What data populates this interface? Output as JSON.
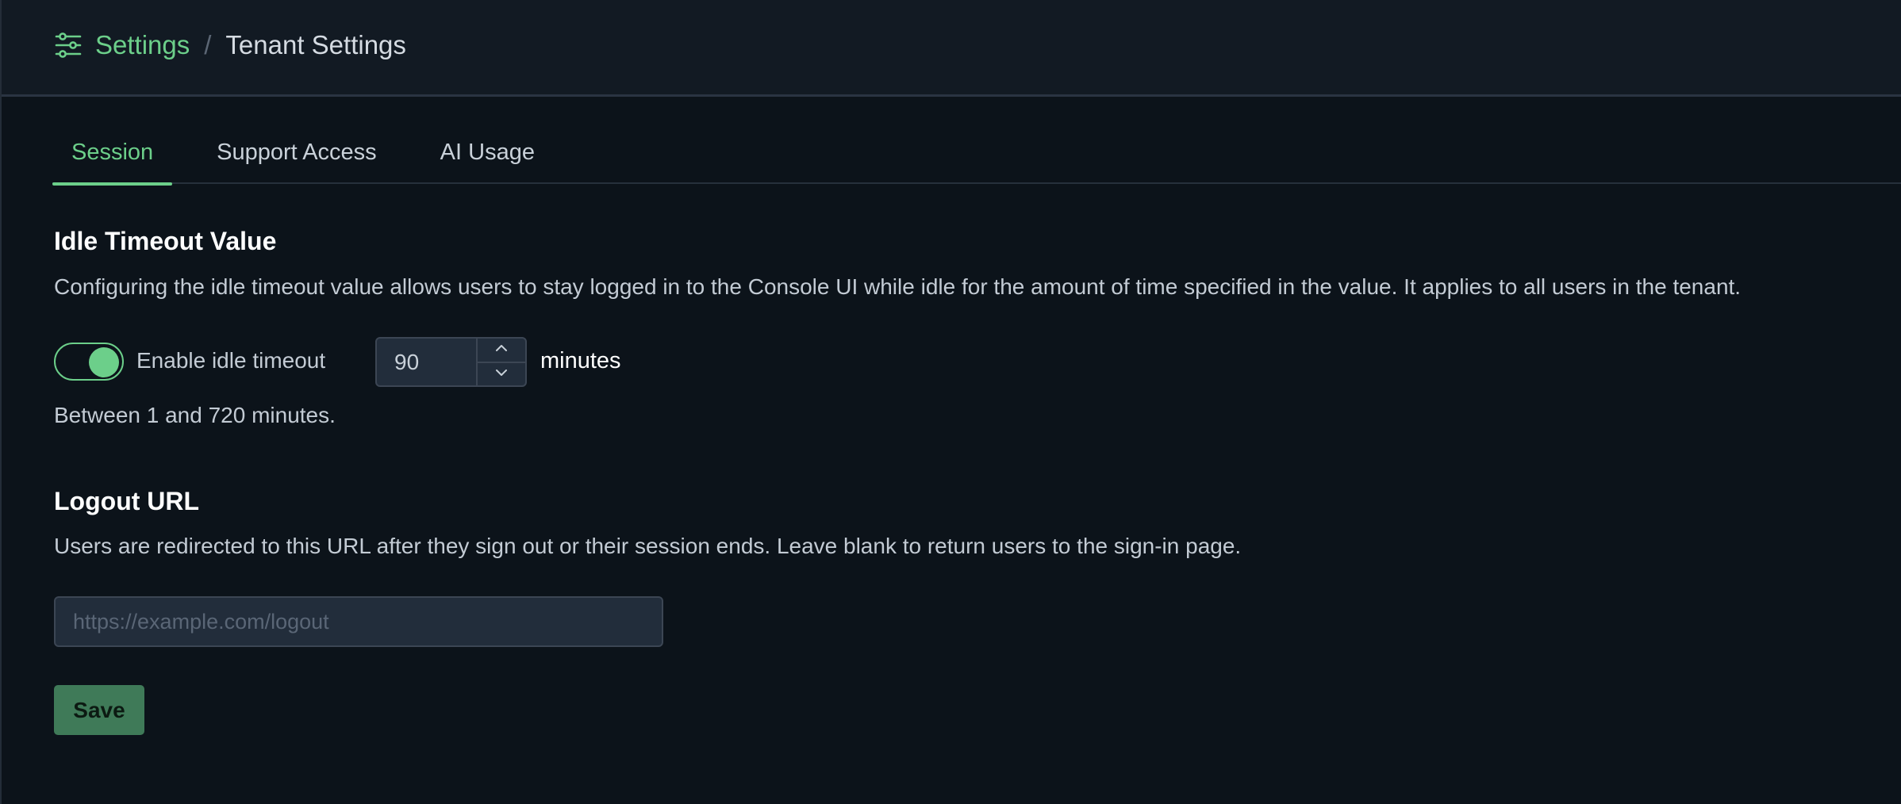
{
  "breadcrumb": {
    "root": "Settings",
    "separator": "/",
    "current": "Tenant Settings"
  },
  "tabs": [
    {
      "label": "Session",
      "active": true
    },
    {
      "label": "Support Access",
      "active": false
    },
    {
      "label": "AI Usage",
      "active": false
    }
  ],
  "idle_timeout": {
    "title": "Idle Timeout Value",
    "description": "Configuring the idle timeout value allows users to stay logged in to the Console UI while idle for the amount of time specified in the value. It applies to all users in the tenant.",
    "toggle_label": "Enable idle timeout",
    "toggle_enabled": true,
    "value": "90",
    "unit": "minutes",
    "hint": "Between 1 and 720 minutes."
  },
  "logout_url": {
    "title": "Logout URL",
    "description": "Users are redirected to this URL after they sign out or their session ends. Leave blank to return users to the sign-in page.",
    "value": "",
    "placeholder": "https://example.com/logout"
  },
  "actions": {
    "save_label": "Save"
  },
  "colors": {
    "accent": "#6ccf8a",
    "background": "#0c131a",
    "header_background": "#121a23",
    "button": "#3f7a58"
  },
  "icons": {
    "breadcrumb": "sliders-icon",
    "step_up": "chevron-up-icon",
    "step_down": "chevron-down-icon"
  }
}
